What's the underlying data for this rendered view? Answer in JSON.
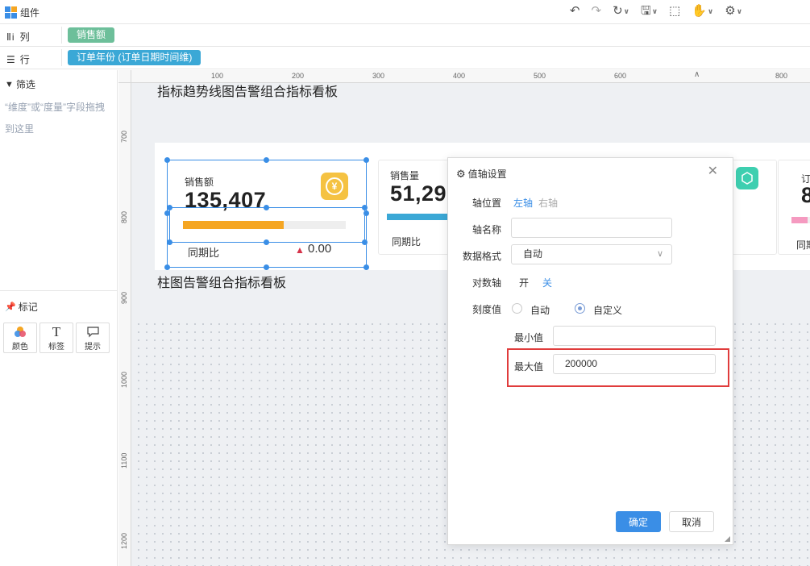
{
  "topbar": {
    "title": "组件"
  },
  "shelves": {
    "columns": {
      "label": "列",
      "pill": "销售额",
      "pill_color": "#6dbf9a"
    },
    "rows": {
      "label": "行",
      "pill": "订单年份 (订单日期时间维)",
      "pill_color": "#3ba8d6"
    }
  },
  "left": {
    "filter_title": "筛选",
    "filter_hint": "“维度”或“度量”字段拖拽到这里",
    "marks_title": "标记",
    "marks": [
      {
        "label": "颜色",
        "icon": "color-icon"
      },
      {
        "label": "标签",
        "icon": "text-icon"
      },
      {
        "label": "提示",
        "icon": "tooltip-icon"
      }
    ]
  },
  "ruler": {
    "top": [
      "100",
      "200",
      "300",
      "400",
      "500",
      "600",
      "800"
    ],
    "left": [
      "700",
      "800",
      "900",
      "1000",
      "1100",
      "1200"
    ]
  },
  "board": {
    "title1": "指标趋势线图告警组合指标看板",
    "title2": "柱图告警组合指标看板",
    "cards": [
      {
        "name": "销售额",
        "value": "135,407",
        "compare_label": "同期比",
        "compare_value": "0.00",
        "progress": 0.62,
        "bar_color": "#f5a623"
      },
      {
        "name": "销售量",
        "value": "51,29",
        "compare_label": "同期比",
        "progress": 0.5,
        "bar_color": "#3ba8d6"
      },
      {
        "name": "订",
        "value": "8",
        "compare_label": "同期",
        "progress": 0.5,
        "bar_color": "#f59ac0"
      }
    ],
    "accent_colors": {
      "coin": "#f5c242",
      "teal": "#3ecfb0",
      "up_arrow": "#d6334a"
    }
  },
  "dialog": {
    "title": "值轴设置",
    "axis_position_label": "轴位置",
    "axis_position_left": "左轴",
    "axis_position_right": "右轴",
    "axis_name_label": "轴名称",
    "axis_name_value": "",
    "format_label": "数据格式",
    "format_value": "自动",
    "log_label": "对数轴",
    "log_on": "开",
    "log_off": "关",
    "scale_label": "刻度值",
    "scale_auto": "自动",
    "scale_custom": "自定义",
    "min_label": "最小值",
    "min_value": "",
    "max_label": "最大值",
    "max_value": "200000",
    "ok": "确定",
    "cancel": "取消"
  }
}
